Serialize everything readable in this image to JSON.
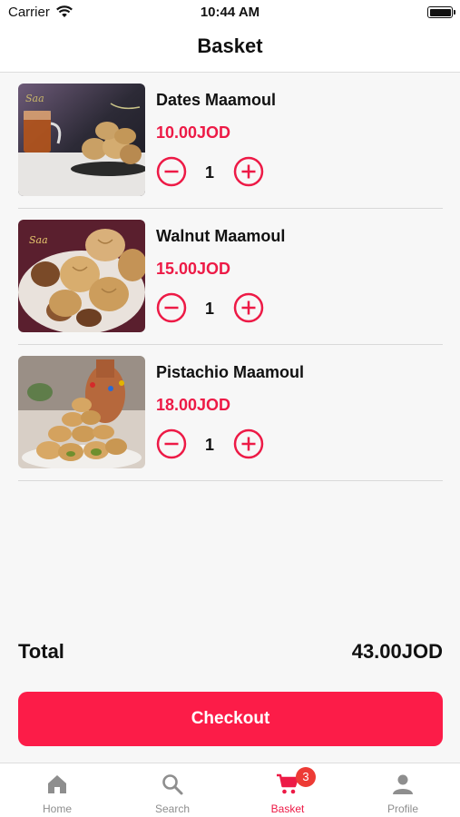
{
  "status_bar": {
    "carrier": "Carrier",
    "time": "10:44 AM"
  },
  "header": {
    "title": "Basket"
  },
  "basket": {
    "items": [
      {
        "name": "Dates Maamoul",
        "price": "10.00JOD",
        "quantity": "1"
      },
      {
        "name": "Walnut Maamoul",
        "price": "15.00JOD",
        "quantity": "1"
      },
      {
        "name": "Pistachio Maamoul",
        "price": "18.00JOD",
        "quantity": "1"
      }
    ]
  },
  "summary": {
    "total_label": "Total",
    "total_value": "43.00JOD"
  },
  "checkout": {
    "label": "Checkout"
  },
  "tab_bar": {
    "tabs": [
      {
        "label": "Home",
        "icon": "home-icon"
      },
      {
        "label": "Search",
        "icon": "search-icon"
      },
      {
        "label": "Basket",
        "icon": "cart-icon",
        "badge": "3"
      },
      {
        "label": "Profile",
        "icon": "person-icon"
      }
    ]
  },
  "colors": {
    "accent": "#ed1a46",
    "button": "#fc1c48",
    "badge": "#ed3b35",
    "inactive": "#8e8e8e"
  }
}
